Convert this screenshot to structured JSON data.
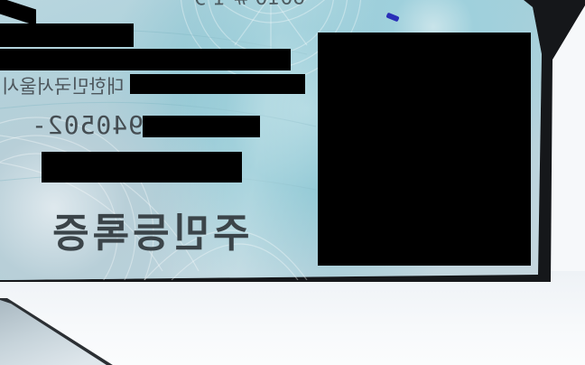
{
  "card": {
    "top_partial_text": "6010 # 1 9",
    "address_partial_text": "대한민국서울시",
    "id_number_prefix": "940502-",
    "card_title": "주민등록증"
  },
  "colors": {
    "card_base": "#a7cfd9",
    "card_edge": "#15171a",
    "redaction": "#000000",
    "text": "#3e474c",
    "background": "#f6f8fa"
  }
}
